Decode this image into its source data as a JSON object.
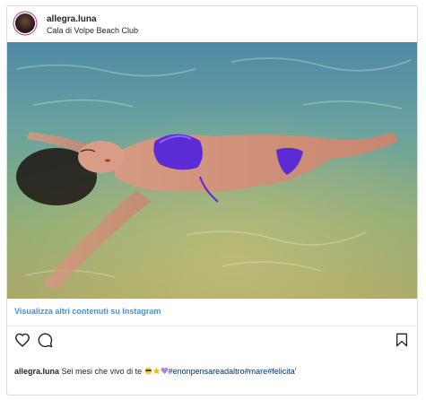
{
  "header": {
    "username": "allegra.luna",
    "location": "Cala di Volpe Beach Club"
  },
  "post": {
    "view_more_label": "Visualizza altri contenuti su Instagram",
    "caption_user": "allegra.luna",
    "caption_text": "Sei mesi che vivo di te",
    "caption_emojis": [
      "sunglasses-emoji",
      "star-emoji",
      "purple-heart-emoji"
    ],
    "caption_hashtags": "#enonpensareadaltro#mare#felicita'"
  },
  "icons": {
    "like": "heart-icon",
    "comment": "comment-icon",
    "save": "bookmark-icon"
  },
  "colors": {
    "link_blue": "#3897f0",
    "hashtag": "#003569",
    "border": "#dbdbdb",
    "bikini": "#5b2bd6"
  }
}
